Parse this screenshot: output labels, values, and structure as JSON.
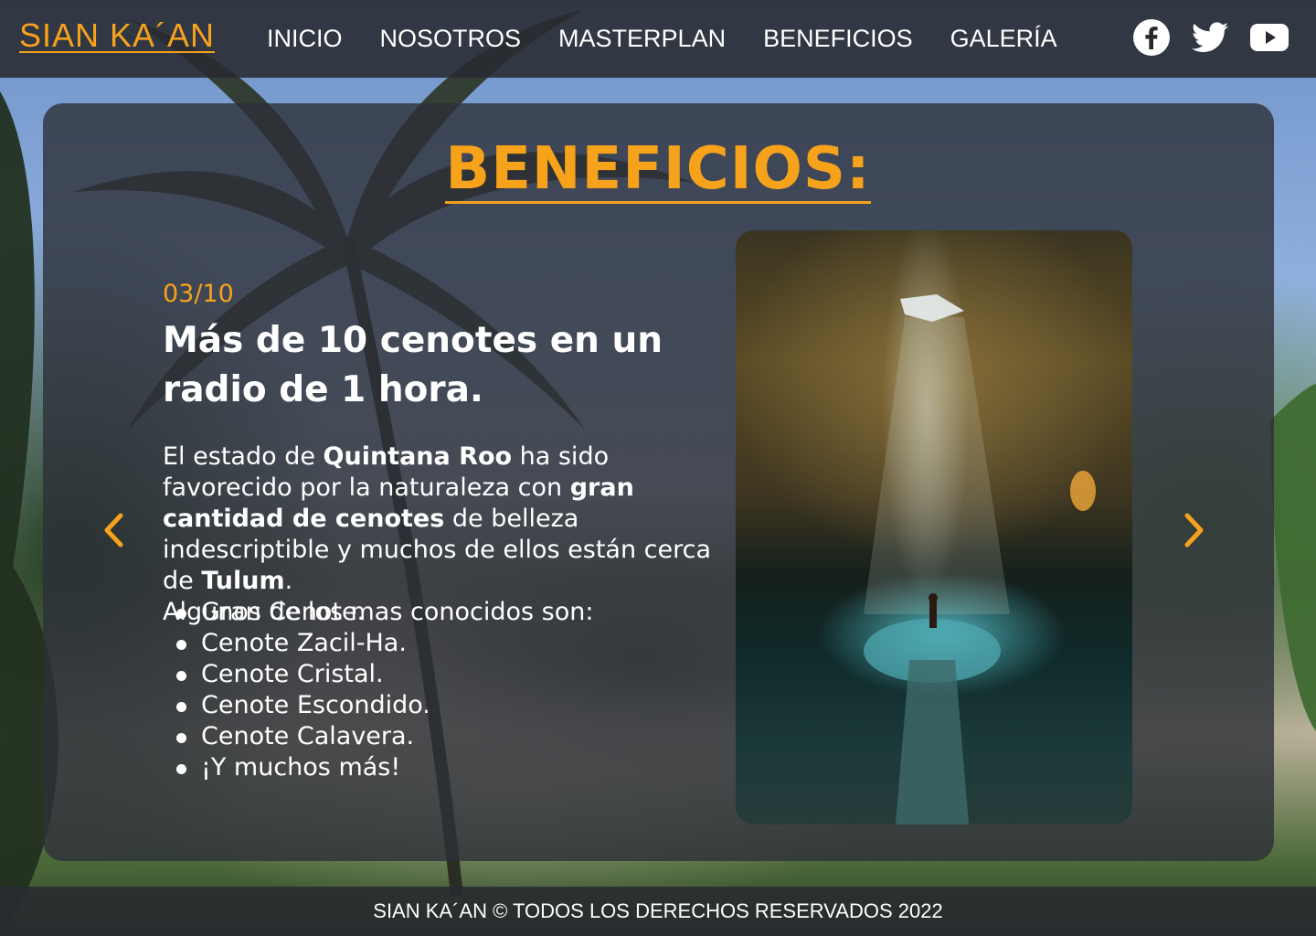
{
  "header": {
    "logo": "SIAN KA´AN",
    "nav": [
      "INICIO",
      "NOSOTROS",
      "MASTERPLAN",
      "BENEFICIOS",
      "GALERÍA"
    ],
    "social_icons": [
      "facebook-icon",
      "twitter-icon",
      "youtube-icon"
    ]
  },
  "section": {
    "title": "BENEFICIOS:"
  },
  "slide": {
    "counter": "03/10",
    "title": "Más de 10 cenotes en un radio de 1 hora.",
    "paragraph": {
      "t1": "El estado de ",
      "b1": "Quintana Roo",
      "t2": " ha sido favorecido por la naturaleza con ",
      "b2": "gran cantidad de cenotes",
      "t3": " de belleza indescriptible y muchos de ellos están cerca de ",
      "b3": "Tulum",
      "t4": ".",
      "t5": "Algunos de los mas conocidos son:"
    },
    "list": [
      "Gran Cenote.",
      "Cenote Zacil-Ha.",
      "Cenote Cristal.",
      "Cenote Escondido.",
      "Cenote Calavera.",
      "¡Y muchos más!"
    ],
    "prev_icon": "chevron-left-icon",
    "next_icon": "chevron-right-icon"
  },
  "colors": {
    "accent": "#f7a21b",
    "panel": "#2d2f38",
    "header": "#282a30"
  },
  "footer": {
    "text": "SIAN KA´AN © TODOS LOS DERECHOS RESERVADOS 2022"
  }
}
